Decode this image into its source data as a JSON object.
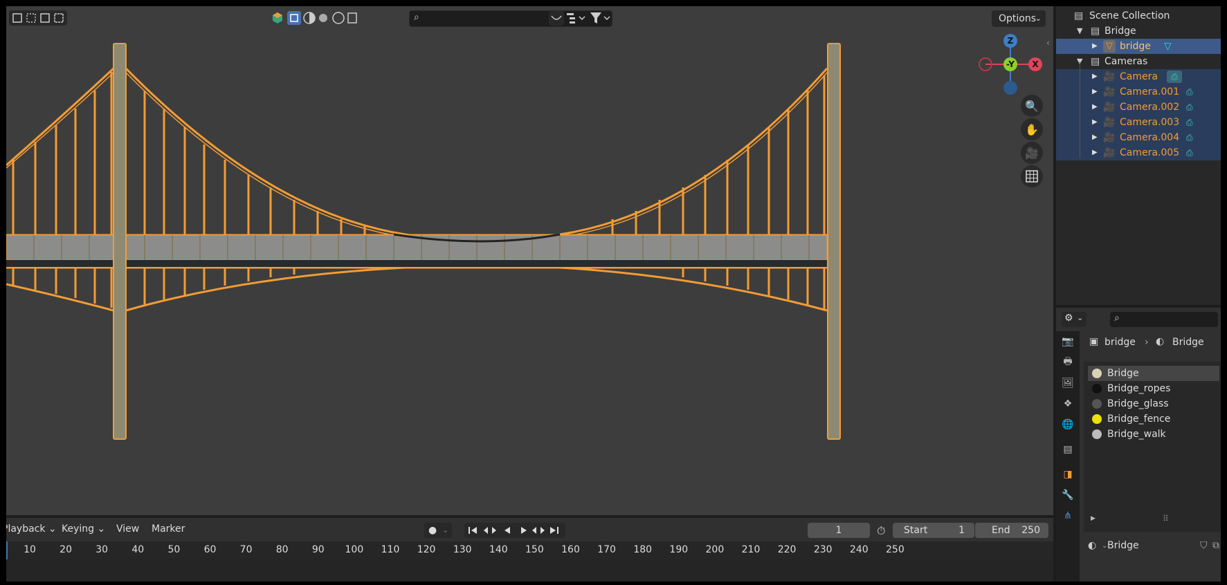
{
  "viewport": {
    "search": {
      "placeholder": ""
    },
    "options_label": "Options",
    "gizmo": {
      "z": "Z",
      "y": "-Y",
      "x": "X"
    }
  },
  "timeline": {
    "menus": [
      "Playback",
      "Keying",
      "View",
      "Marker"
    ],
    "current_frame": "1",
    "start_label": "Start",
    "start_value": "1",
    "end_label": "End",
    "end_value": "250",
    "ticks": [
      "10",
      "20",
      "30",
      "40",
      "50",
      "60",
      "70",
      "80",
      "90",
      "100",
      "110",
      "120",
      "130",
      "140",
      "150",
      "160",
      "170",
      "180",
      "190",
      "200",
      "210",
      "220",
      "230",
      "240",
      "250"
    ]
  },
  "outliner": {
    "title": "Scene Collection",
    "rows": [
      {
        "label": "Bridge",
        "type": "collection"
      },
      {
        "label": "bridge",
        "type": "mesh"
      },
      {
        "label": "Cameras",
        "type": "collection"
      },
      {
        "label": "Camera",
        "type": "camera"
      },
      {
        "label": "Camera.001",
        "type": "camera"
      },
      {
        "label": "Camera.002",
        "type": "camera"
      },
      {
        "label": "Camera.003",
        "type": "camera"
      },
      {
        "label": "Camera.004",
        "type": "camera"
      },
      {
        "label": "Camera.005",
        "type": "camera"
      }
    ]
  },
  "properties": {
    "breadcrumb": {
      "object": "bridge",
      "material": "Bridge"
    },
    "materials": [
      {
        "label": "Bridge",
        "color": "#d8d2b4"
      },
      {
        "label": "Bridge_ropes",
        "color": "#111111"
      },
      {
        "label": "Bridge_glass",
        "color": "#555555"
      },
      {
        "label": "Bridge_fence",
        "color": "#f0e000"
      },
      {
        "label": "Bridge_walk",
        "color": "#bbbbbb"
      }
    ],
    "active_material": "Bridge"
  },
  "colors": {
    "selection": "#f39c35",
    "accent_blue": "#4772b3"
  }
}
